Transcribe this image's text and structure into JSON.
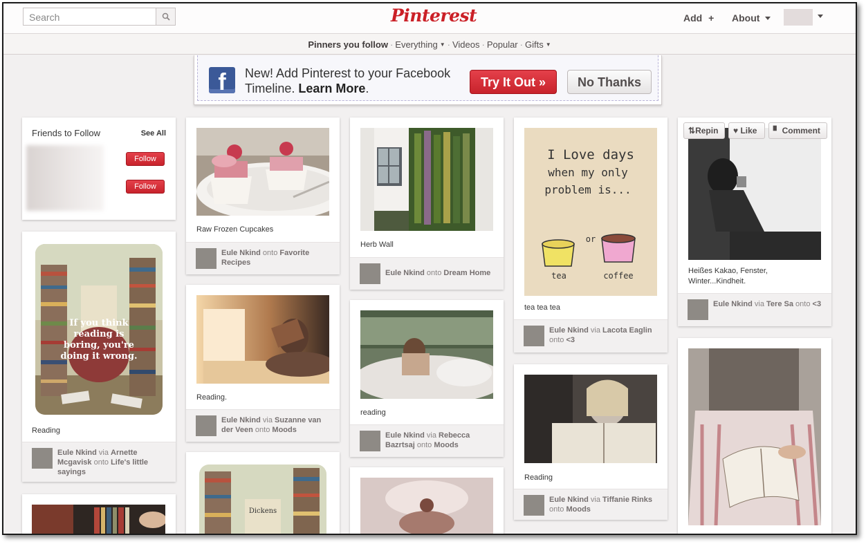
{
  "search": {
    "placeholder": "Search"
  },
  "logo": "Pinterest",
  "header": {
    "add_label": "Add",
    "add_icon": "+",
    "about_label": "About"
  },
  "subnav": {
    "items": [
      "Pinners you follow",
      "Everything",
      "Videos",
      "Popular",
      "Gifts"
    ],
    "separator": "·"
  },
  "facebook_banner": {
    "fb_icon": "f",
    "text_line1": "New! Add Pinterest to your Facebook",
    "text_line2": "Timeline.",
    "learn_more": "Learn More",
    "period": ".",
    "try_button": "Try It Out »",
    "no_button": "No Thanks"
  },
  "friends": {
    "title": "Friends to Follow",
    "see_all": "See All",
    "follow_label": "Follow"
  },
  "pin_actions": {
    "repin": "Repin",
    "like": "Like",
    "comment": "Comment"
  },
  "pins": {
    "reading_quote": {
      "description": "Reading",
      "user": "Eule Nkind",
      "via_word": "via",
      "via_user": "Arnette Mcgavisk",
      "onto_word": "onto",
      "board": "Life's little sayings",
      "quote": "If you think reading is boring, you're doing it wrong."
    },
    "cupcakes": {
      "description": "Raw Frozen Cupcakes",
      "user": "Eule Nkind",
      "onto_word": "onto",
      "board": "Favorite Recipes"
    },
    "reading_window": {
      "description": "Reading.",
      "user": "Eule Nkind",
      "via_word": "via",
      "via_user": "Suzanne van der Veen",
      "onto_word": "onto",
      "board": "Moods"
    },
    "herb_wall": {
      "description": "Herb Wall",
      "user": "Eule Nkind",
      "onto_word": "onto",
      "board": "Dream Home"
    },
    "reading_bed": {
      "description": "reading",
      "user": "Eule Nkind",
      "via_word": "via",
      "via_user": "Rebecca Bazrtsaj",
      "onto_word": "onto",
      "board": "Moods"
    },
    "tea": {
      "description": "tea tea tea",
      "user": "Eule Nkind",
      "via_word": "via",
      "via_user": "Lacota Eaglin",
      "onto_word": "onto",
      "board": "<3",
      "art_line1": "I Love days",
      "art_line2": "when my only",
      "art_line3": "problem is...",
      "art_or": "or",
      "art_tea": "tea",
      "art_coffee": "coffee"
    },
    "reading_smile": {
      "description": "Reading",
      "user": "Eule Nkind",
      "via_word": "via",
      "via_user": "Tiffanie Rinks",
      "onto_word": "onto",
      "board": "Moods"
    },
    "kakao": {
      "description": "Heißes Kakao, Fenster, Winter...Kindheit.",
      "user": "Eule Nkind",
      "via_word": "via",
      "via_user": "Tere Sa",
      "onto_word": "onto",
      "board": "<3"
    }
  }
}
